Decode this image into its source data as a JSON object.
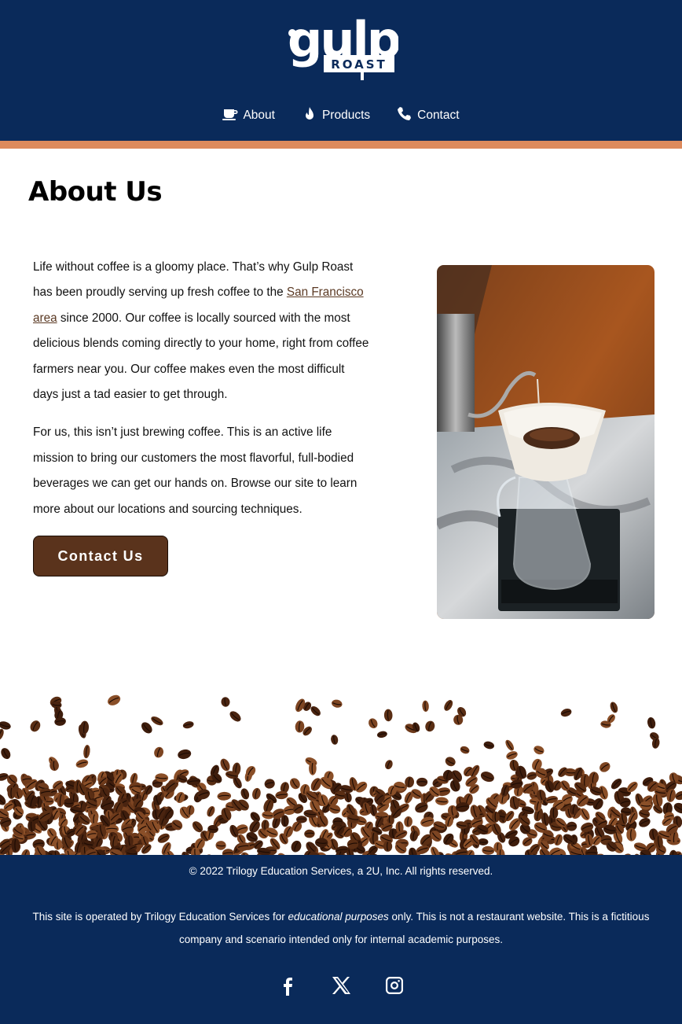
{
  "brand": {
    "logo_text": "gulp",
    "logo_subtext": "ROAST"
  },
  "nav": {
    "items": [
      {
        "label": "About",
        "icon": "coffee-cup-icon"
      },
      {
        "label": "Products",
        "icon": "flame-drop-icon"
      },
      {
        "label": "Contact",
        "icon": "phone-icon"
      }
    ]
  },
  "main": {
    "title": "About Us",
    "paragraph1_before_link": "Life without coffee is a gloomy place. That’s why Gulp Roast has been proudly serving up fresh coffee to the ",
    "paragraph1_link": "San Francisco area",
    "paragraph1_after_link": " since 2000. Our coffee is locally sourced with the most delicious blends coming directly to your home, right from coffee farmers near you. Our coffee makes even the most difficult days just a tad easier to get through.",
    "paragraph2": "For us, this isn’t just brewing coffee. This is an active life mission to bring our customers the most flavorful, full-bodied beverages we can get our hands on. Browse our site to learn more about our locations and sourcing techniques.",
    "cta_label": "Contact Us"
  },
  "footer": {
    "copyright": "© 2022 Trilogy Education Services, a 2U, Inc. All rights reserved.",
    "disclaimer_before": "This site is operated by Trilogy Education Services for ",
    "disclaimer_em": "educational purposes",
    "disclaimer_after": " only. This is not a restaurant website. This is a fictitious company and scenario intended only for internal academic purposes.",
    "socials": [
      "facebook-icon",
      "x-twitter-icon",
      "instagram-icon"
    ]
  },
  "colors": {
    "navy": "#0a2a5a",
    "accent": "#dd8a5c",
    "button_brown": "#5a331c",
    "link_brown": "#5b3a24"
  }
}
